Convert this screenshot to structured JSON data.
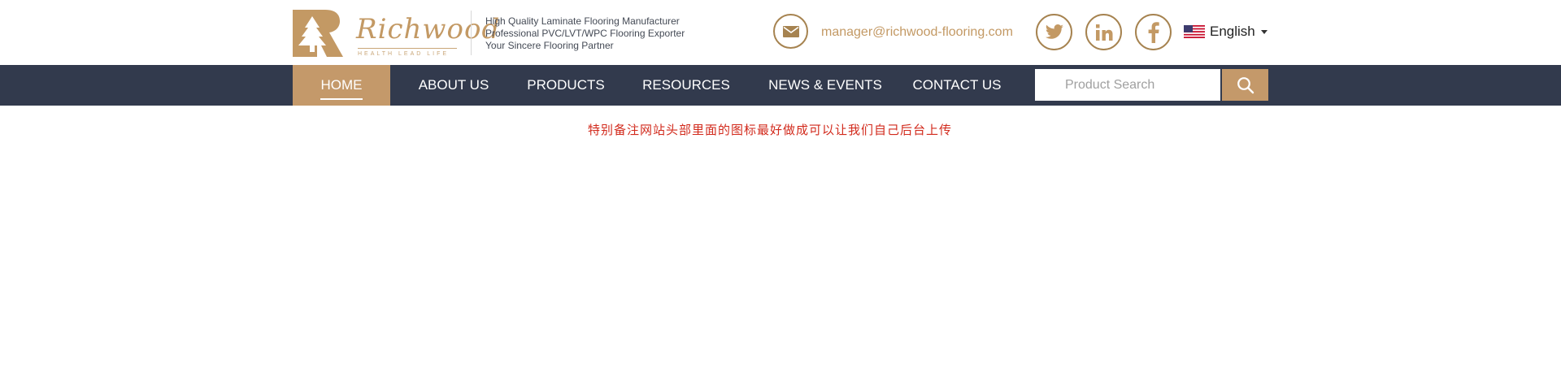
{
  "header": {
    "brand": {
      "name": "Richwood",
      "tagline": "HEALTH LEAD LIFE"
    },
    "taglines": [
      "High Quality Laminate Flooring Manufacturer",
      "Professional PVC/LVT/WPC Flooring Exporter",
      "Your Sincere Flooring Partner"
    ],
    "email": "manager@richwood-flooring.com",
    "social": [
      "twitter-icon",
      "linkedin-icon",
      "facebook-icon"
    ],
    "language": "English"
  },
  "nav": {
    "items": [
      {
        "label": "HOME"
      },
      {
        "label": "ABOUT US"
      },
      {
        "label": "PRODUCTS"
      },
      {
        "label": "RESOURCES"
      },
      {
        "label": "NEWS & EVENTS"
      },
      {
        "label": "CONTACT US"
      }
    ],
    "search_placeholder": "Product Search"
  },
  "notice": "特别备注网站头部里面的图标最好做成可以让我们自己后台上传",
  "colors": {
    "accent": "#c4996a",
    "nav_bg": "#323a4d",
    "notice": "#d22a1c",
    "icon_border": "#a68350"
  }
}
